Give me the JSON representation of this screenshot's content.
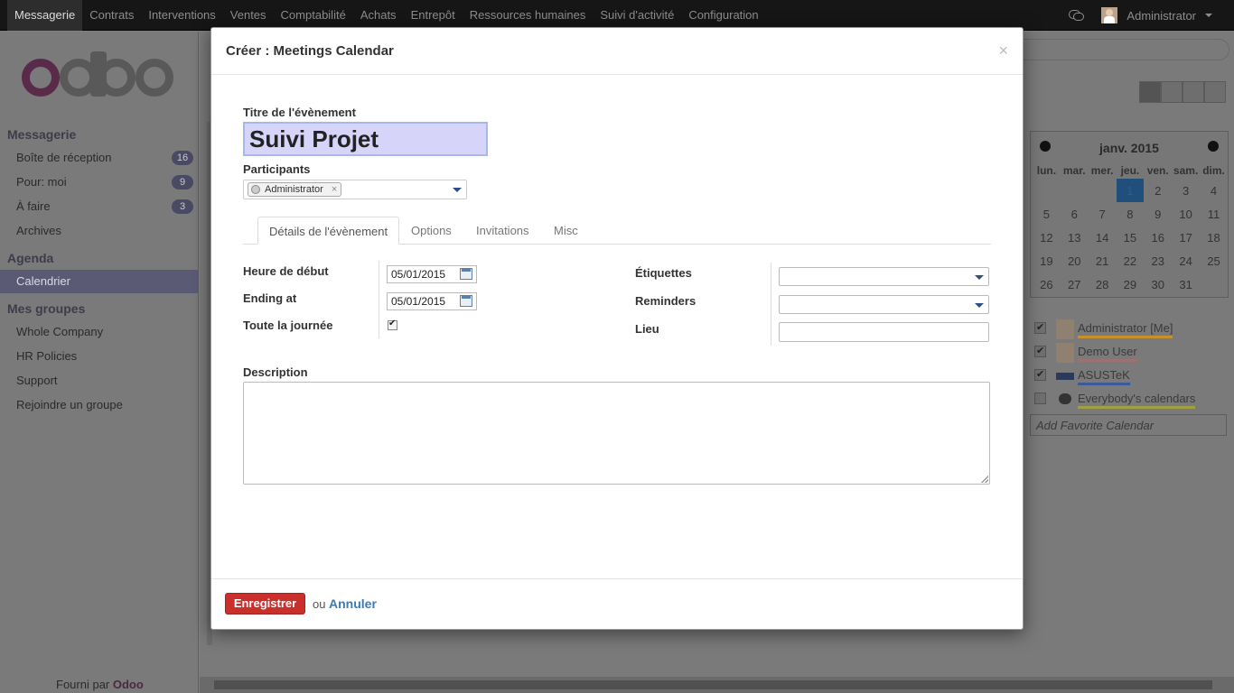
{
  "topbar": {
    "menu": [
      "Messagerie",
      "Contrats",
      "Interventions",
      "Ventes",
      "Comptabilité",
      "Achats",
      "Entrepôt",
      "Ressources humaines",
      "Suivi d'activité",
      "Configuration"
    ],
    "user": "Administrator"
  },
  "sidebar": {
    "sections": [
      {
        "title": "Messagerie"
      },
      {
        "title": "Agenda"
      },
      {
        "title": "Mes groupes"
      }
    ],
    "messagerie_items": [
      {
        "label": "Boîte de réception",
        "badge": "16"
      },
      {
        "label": "Pour: moi",
        "badge": "9"
      },
      {
        "label": "À faire",
        "badge": "3"
      },
      {
        "label": "Archives",
        "badge": ""
      }
    ],
    "agenda_items": [
      {
        "label": "Calendrier"
      }
    ],
    "group_items": [
      {
        "label": "Whole Company"
      },
      {
        "label": "HR Policies"
      },
      {
        "label": "Support"
      },
      {
        "label": "Rejoindre un groupe"
      }
    ],
    "powered_prefix": "Fourni par",
    "powered_brand": "Odoo"
  },
  "mini_calendar": {
    "month": "janv. 2015",
    "weekdays": [
      "lun.",
      "mar.",
      "mer.",
      "jeu.",
      "ven.",
      "sam.",
      "dim."
    ],
    "weeks": [
      [
        "",
        "",
        "",
        "1",
        "2",
        "3",
        "4"
      ],
      [
        "5",
        "6",
        "7",
        "8",
        "9",
        "10",
        "11"
      ],
      [
        "12",
        "13",
        "14",
        "15",
        "16",
        "17",
        "18"
      ],
      [
        "19",
        "20",
        "21",
        "22",
        "23",
        "24",
        "25"
      ],
      [
        "26",
        "27",
        "28",
        "29",
        "30",
        "31",
        ""
      ]
    ],
    "today": "1"
  },
  "calendars": [
    {
      "label": "Administrator [Me]",
      "checked": true,
      "color": "#c8902a"
    },
    {
      "label": "Demo User",
      "checked": true,
      "color": "#a07070"
    },
    {
      "label": "ASUSTeK",
      "checked": true,
      "color": "#3a5a9a"
    },
    {
      "label": "Everybody's calendars",
      "checked": false,
      "color": "#a0a040"
    }
  ],
  "add_favorite_placeholder": "Add Favorite Calendar",
  "modal": {
    "title": "Créer : Meetings Calendar",
    "close": "×",
    "event_title_label": "Titre de l'évènement",
    "event_title_value": "Suivi Projet",
    "participants_label": "Participants",
    "participant_tag": "Administrator",
    "tag_remove": "×",
    "tabs": [
      "Détails de l'évènement",
      "Options",
      "Invitations",
      "Misc"
    ],
    "start_label": "Heure de début",
    "start_value": "05/01/2015",
    "end_label": "Ending at",
    "end_value": "05/01/2015",
    "allday_label": "Toute la journée",
    "allday_checked": true,
    "tags_label": "Étiquettes",
    "reminders_label": "Reminders",
    "location_label": "Lieu",
    "description_label": "Description",
    "save": "Enregistrer",
    "or": "ou",
    "cancel": "Annuler"
  }
}
